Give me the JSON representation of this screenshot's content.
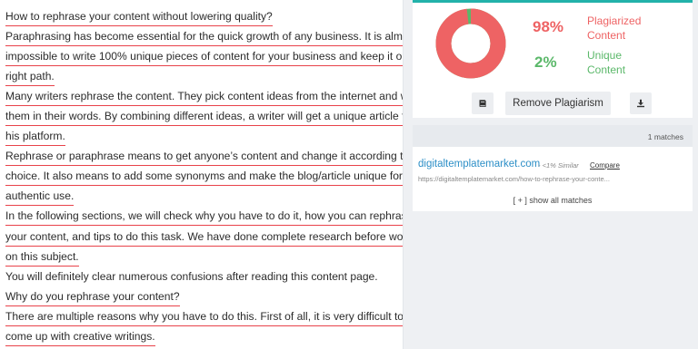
{
  "content": {
    "lines": [
      {
        "text": "How to rephrase your content without lowering quality?",
        "highlighted": true
      },
      {
        "text": "Paraphrasing has become essential for the quick growth of any business. It is almost",
        "highlighted": true
      },
      {
        "text": "impossible to write 100% unique pieces of content for your business and keep it on the",
        "highlighted": true
      },
      {
        "text": "right path.",
        "highlighted": true
      },
      {
        "text": "Many writers rephrase the content. They pick content ideas from the internet and write",
        "highlighted": true
      },
      {
        "text": "them in their words. By combining different ideas, a writer will get a unique article for",
        "highlighted": true
      },
      {
        "text": "his platform.",
        "highlighted": true
      },
      {
        "text": "Rephrase or paraphrase means to get anyone’s content and change it according to your",
        "highlighted": true
      },
      {
        "text": "choice. It also means to add some synonyms and make the blog/article unique for your",
        "highlighted": true
      },
      {
        "text": "authentic use.",
        "highlighted": true
      },
      {
        "text": "In the following sections, we will check why you have to do it, how you can rephrase",
        "highlighted": true
      },
      {
        "text": "your content, and tips to do this task. We have done complete research before working",
        "highlighted": true
      },
      {
        "text": "on this subject.",
        "highlighted": true
      },
      {
        "text": "You will definitely clear numerous confusions after reading this content page.",
        "highlighted": false
      },
      {
        "text": "Why do you rephrase your content?",
        "highlighted": true
      },
      {
        "text": "There are multiple reasons why you have to do this. First of all, it is very difficult to",
        "highlighted": true
      },
      {
        "text": "come up with creative writings.",
        "highlighted": true
      }
    ]
  },
  "score": {
    "plagiarized_pct": "98%",
    "plagiarized_label": "Plagiarized Content",
    "unique_pct": "2%",
    "unique_label": "Unique Content",
    "plagiarized_fraction": 0.98,
    "colors": {
      "plagiarized": "#ee6364",
      "unique": "#5bb86a",
      "accent": "#22b2aa"
    }
  },
  "actions": {
    "book_icon": "book-icon",
    "remove_label": "Remove Plagiarism",
    "download_icon": "download-icon"
  },
  "matches": {
    "header": "1 matches",
    "items": [
      {
        "domain": "digitaltemplatemarket.com",
        "similarity": "- <1% Similar",
        "compare_label": "Compare",
        "url": "https://digitaltemplatemarket.com/how-to-rephrase-your-conte..."
      }
    ],
    "show_all_label": "[ + ] show all matches"
  }
}
